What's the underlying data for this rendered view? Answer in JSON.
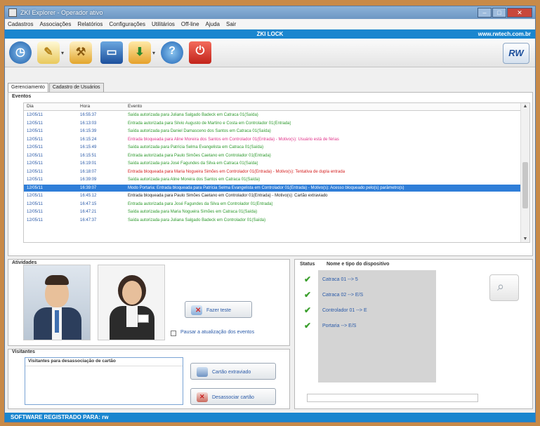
{
  "window": {
    "title": "ZKI Explorer - Operador ativo"
  },
  "menu": [
    "Cadastros",
    "Associações",
    "Relatórios",
    "Configurações",
    "Utilitários",
    "Off-line",
    "Ajuda",
    "Sair"
  ],
  "banner": {
    "center": "ZKI LOCK",
    "url": "www.rwtech.com.br"
  },
  "toolbar": {
    "brand": "RW"
  },
  "tabs": [
    "Gerenciamento",
    "Cadastro de Usuários"
  ],
  "events": {
    "label": "Eventos",
    "columns": [
      "Dia",
      "Hora",
      "Evento"
    ],
    "rows": [
      {
        "dia": "12/05/11",
        "hora": "16:55:37",
        "evento": "Saída autorizada para Juliana Salgado Badeck em Catraca 01(Saída)",
        "tipo": "ok"
      },
      {
        "dia": "12/05/11",
        "hora": "16:13:03",
        "evento": "Entrada autorizada para Silvio Augusto de Martino e Costa em Controlador 01(Entrada)",
        "tipo": "ok"
      },
      {
        "dia": "12/05/11",
        "hora": "16:15:39",
        "evento": "Saída autorizada para Daniel Damasceno dos Santos em Catraca 01(Saída)",
        "tipo": "ok"
      },
      {
        "dia": "12/05/11",
        "hora": "16:15:24",
        "evento": "Entrada bloqueada para Aline Moreira dos Santos em Controlador 01(Entrada) - Motivo(s): Usuário está de férias",
        "tipo": "pink"
      },
      {
        "dia": "12/05/11",
        "hora": "16:15:49",
        "evento": "Saída autorizada para Patrícia Selma Evangelista em Catraca 01(Saída)",
        "tipo": "ok"
      },
      {
        "dia": "12/05/11",
        "hora": "16:15:51",
        "evento": "Entrada autorizada para Paulo Simões Caetano em Controlador 01(Entrada)",
        "tipo": "ok"
      },
      {
        "dia": "12/05/11",
        "hora": "16:19:01",
        "evento": "Saída autorizada para José Fagundes da Silva em Catraca 01(Saída)",
        "tipo": "ok"
      },
      {
        "dia": "12/05/11",
        "hora": "16:18:07",
        "evento": "Entrada bloqueada para Maria Nogueira Simões em Controlador 01(Entrada) - Motivo(s): Tentativa de dupla entrada",
        "tipo": "red"
      },
      {
        "dia": "12/05/11",
        "hora": "16:39:09",
        "evento": "Saída autorizada para Aline Moreira dos Santos em Catraca 01(Saída)",
        "tipo": "ok"
      },
      {
        "dia": "12/05/11",
        "hora": "16:39:07",
        "evento": "Modo Portaria: Entrada bloqueada para Patrícia Selma Evangelista em Controlador 01(Entrada) - Motivo(s): Acesso bloqueado pelo(s) parâmetro(s)",
        "tipo": "sel"
      },
      {
        "dia": "12/05/11",
        "hora": "16:45:12",
        "evento": "Entrada bloqueada para Paulo Simões Caetano em Controlador 01(Entrada) - Motivo(s): Cartão extraviado",
        "tipo": "black"
      },
      {
        "dia": "12/05/11",
        "hora": "16:47:15",
        "evento": "Entrada autorizada para José Fagundes da Silva em Controlador 01(Entrada)",
        "tipo": "ok"
      },
      {
        "dia": "12/05/11",
        "hora": "16:47:21",
        "evento": "Saída autorizada para Maria Nogueira Simões em Catraca 01(Saída)",
        "tipo": "ok"
      },
      {
        "dia": "12/05/11",
        "hora": "16:47:37",
        "evento": "Saída autorizada para Juliana Salgado Badeck em Controlador 01(Saída)",
        "tipo": "ok"
      }
    ]
  },
  "activities": {
    "label": "Atividades",
    "pause_label": "Pausar a atualização dos eventos",
    "fazer_label": "Fazer teste"
  },
  "visitors": {
    "label": "Visitantes",
    "list_header": "Visitantes para desassociação de cartão",
    "lost_label": "Cartão extraviado",
    "dissoc_label": "Desassociar cartão"
  },
  "devices": {
    "status_label": "Status",
    "name_label": "Nome e tipo do dispositivo",
    "items": [
      "Catraca 01 --> 5",
      "Catraca 02 --> E/S",
      "Controlador 01 --> E",
      "Portaria --> E/S"
    ]
  },
  "statusbar": {
    "text": "SOFTWARE REGISTRADO PARA: rw"
  },
  "colors": {
    "ok": "#2e9a2e",
    "pink": "#e0338a",
    "red": "#d42020",
    "black": "#222222",
    "link": "#2a5aa8",
    "accent": "#1a86cf"
  }
}
